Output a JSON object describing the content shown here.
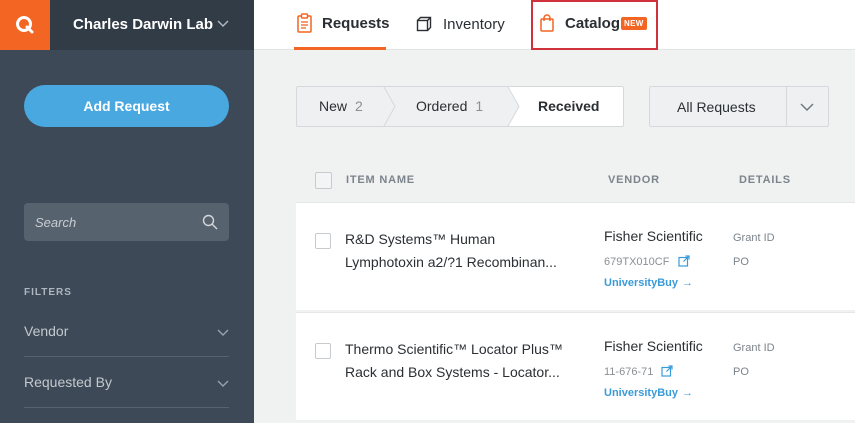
{
  "sidebar": {
    "lab_name": "Charles Darwin Lab",
    "add_request_label": "Add Request",
    "search_placeholder": "Search",
    "filters_title": "FILTERS",
    "filters": [
      {
        "label": "Vendor"
      },
      {
        "label": "Requested By"
      }
    ]
  },
  "topnav": {
    "tabs": [
      {
        "label": "Requests",
        "active": true
      },
      {
        "label": "Inventory"
      },
      {
        "label": "Catalog",
        "badge": "NEW"
      }
    ]
  },
  "status_filter": {
    "segments": [
      {
        "label": "New",
        "count": "2"
      },
      {
        "label": "Ordered",
        "count": "1"
      },
      {
        "label": "Received",
        "active": true
      }
    ],
    "scope_label": "All Requests"
  },
  "table": {
    "headers": {
      "item_name": "ITEM NAME",
      "vendor": "VENDOR",
      "details": "DETAILS"
    },
    "rows": [
      {
        "name_line1": "R&D Systems™ Human",
        "name_line2": "Lymphotoxin a2/?1 Recombinan...",
        "vendor": "Fisher Scientific",
        "sku": "679TX010CF",
        "link": "UniversityBuy",
        "grant_label": "Grant ID",
        "po_label": "PO"
      },
      {
        "name_line1": "Thermo Scientific™ Locator Plus™",
        "name_line2": "Rack and Box Systems - Locator...",
        "vendor": "Fisher Scientific",
        "sku": "11-676-71",
        "link": "UniversityBuy",
        "grant_label": "Grant ID",
        "po_label": "PO"
      }
    ]
  },
  "colors": {
    "brand_orange": "#f26522",
    "accent_blue": "#4aa8e0",
    "sidebar_bg": "#3d4956",
    "highlight_red": "#d0313a"
  }
}
